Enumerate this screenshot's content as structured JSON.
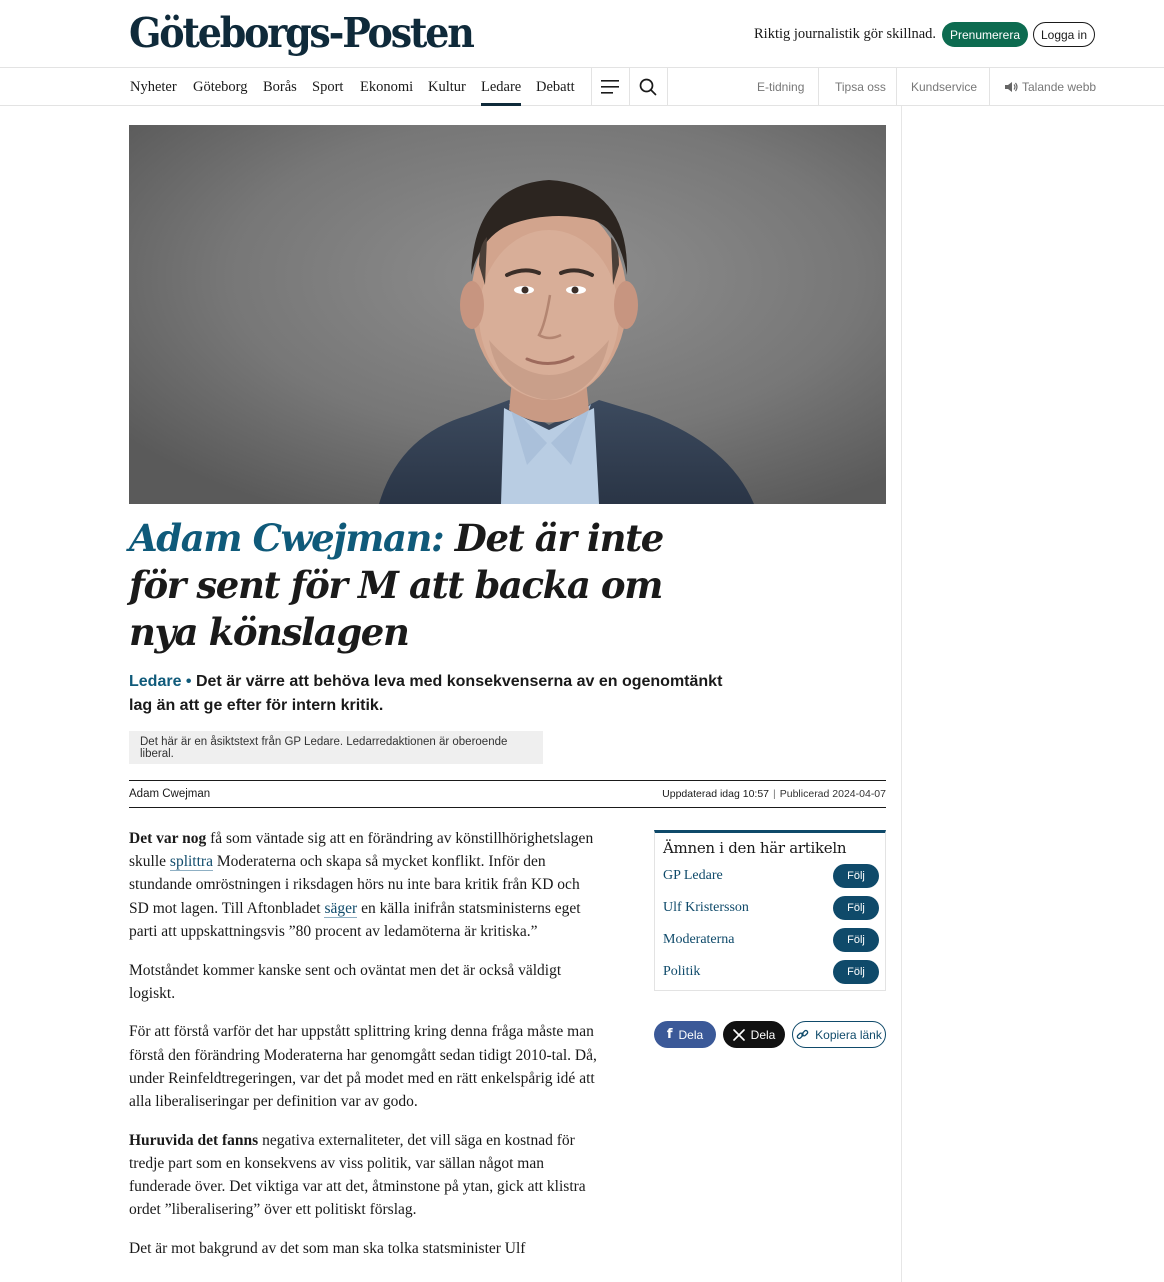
{
  "header": {
    "logo": "Göteborgs-Posten",
    "tagline": "Riktig journalistik gör skillnad.",
    "subscribe_label": "Prenumerera",
    "login_label": "Logga in"
  },
  "nav": {
    "items": [
      {
        "label": "Nyheter"
      },
      {
        "label": "Göteborg"
      },
      {
        "label": "Borås"
      },
      {
        "label": "Sport"
      },
      {
        "label": "Ekonomi"
      },
      {
        "label": "Kultur"
      },
      {
        "label": "Ledare",
        "active": true
      },
      {
        "label": "Debatt"
      }
    ],
    "icons": [
      "menu-icon",
      "search-icon"
    ],
    "right": {
      "etidning": "E-tidning",
      "tipsa": "Tipsa oss",
      "kundservice": "Kundservice",
      "talande": "Talande webb"
    }
  },
  "article": {
    "headline_author": "Adam Cwejman:",
    "headline_rest": " Det är inte för sent för M att backa om nya könslagen",
    "section": "Ledare",
    "lead": " Det är värre att behöva leva med konsekvenserna av en ogenomtänkt lag än att ge efter för intern kritik.",
    "opinion_notice": "Det här är en åsiktstext från GP Ledare. Ledarredaktionen är oberoende liberal.",
    "byline": "Adam Cwejman",
    "updated": "Uppdaterad idag 10:57",
    "published": "Publicerad 2024-04-07",
    "body": {
      "p1": {
        "lead_bold": "Det var nog",
        "t1": " få som väntade sig att en förändring av könstillhörighetslagen skulle ",
        "link1": "splittra",
        "t2": " Moderaterna och skapa så mycket konflikt. Inför den stundande omröstningen i riksdagen hörs nu inte bara kritik från KD och SD mot lagen. Till Aftonbladet ",
        "link2": "säger",
        "t3": " en källa inifrån statsministerns eget parti att uppskattningsvis ”80 procent av ledamöterna är kritiska.”"
      },
      "p2": "Motståndet kommer kanske sent och oväntat men det är också väldigt logiskt.",
      "p3": "För att förstå varför det har uppstått splittring kring denna fråga måste man förstå den förändring Moderaterna har genomgått sedan tidigt 2010-tal. Då, under Reinfeldtregeringen, var det på modet med en rätt enkelspårig idé att alla liberaliseringar per definition var av godo.",
      "p4": {
        "lead_bold": "Huruvida det fanns",
        "text": " negativa externaliteter, det vill säga en kostnad för tredje part som en konsekvens av viss politik, var sällan något man funderade över. Det viktiga var att det, åtminstone på ytan, gick att klistra ordet ”liberalisering” över ett politiskt förslag."
      },
      "p5": "Det är mot bakgrund av det som man ska tolka statsminister Ulf"
    }
  },
  "topics": {
    "title": "Ämnen i den här artikeln",
    "follow_label": "Följ",
    "items": [
      "GP Ledare",
      "Ulf Kristersson",
      "Moderaterna",
      "Politik"
    ]
  },
  "share": {
    "facebook": "Dela",
    "x": "Dela",
    "copy": "Kopiera länk"
  }
}
